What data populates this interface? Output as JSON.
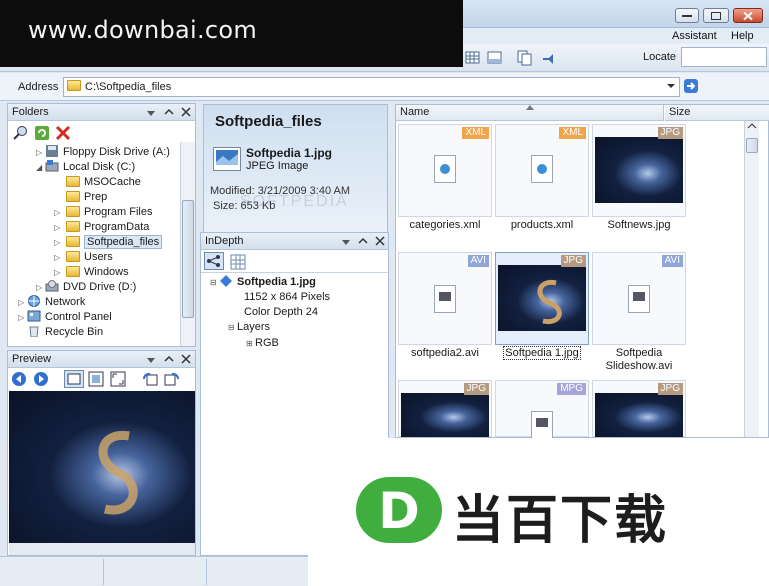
{
  "menu": {
    "assistant": "Assistant",
    "help": "Help"
  },
  "toolbar": {
    "locate_label": "Locate"
  },
  "address": {
    "label": "Address",
    "path": "C:\\Softpedia_files"
  },
  "folders_panel": {
    "title": "Folders",
    "items": [
      {
        "label": "Floppy Disk Drive (A:)",
        "icon": "floppy-icon",
        "depth": 1
      },
      {
        "label": "Local Disk (C:)",
        "icon": "drive-icon",
        "depth": 1
      },
      {
        "label": "MSOCache",
        "icon": "folder-icon",
        "depth": 2
      },
      {
        "label": "Prep",
        "icon": "folder-icon",
        "depth": 2
      },
      {
        "label": "Program Files",
        "icon": "folder-icon",
        "depth": 2
      },
      {
        "label": "ProgramData",
        "icon": "folder-icon",
        "depth": 2
      },
      {
        "label": "Softpedia_files",
        "icon": "folder-icon",
        "depth": 2,
        "selected": true
      },
      {
        "label": "Users",
        "icon": "folder-icon",
        "depth": 2
      },
      {
        "label": "Windows",
        "icon": "folder-icon",
        "depth": 2
      },
      {
        "label": "DVD Drive (D:)",
        "icon": "dvd-icon",
        "depth": 1
      },
      {
        "label": "Network",
        "icon": "network-icon",
        "depth": 0
      },
      {
        "label": "Control Panel",
        "icon": "control-panel-icon",
        "depth": 0
      },
      {
        "label": "Recycle Bin",
        "icon": "recycle-bin-icon",
        "depth": 0
      }
    ]
  },
  "preview_panel": {
    "title": "Preview"
  },
  "info": {
    "folder_name": "Softpedia_files",
    "file_name": "Softpedia 1.jpg",
    "file_type": "JPEG Image",
    "modified": "Modified: 3/21/2009 3:40 AM",
    "size": "Size: 653 Kb"
  },
  "indepth_panel": {
    "title": "InDepth",
    "root": "Softpedia 1.jpg",
    "dimensions": "1152 x 864 Pixels",
    "color_depth": "Color Depth 24",
    "layers": "Layers",
    "layer_child": "RGB"
  },
  "file_list": {
    "columns": {
      "name": "Name",
      "size": "Size"
    },
    "items": [
      {
        "label": "categories.xml",
        "badge": "XML",
        "kind": "doc"
      },
      {
        "label": "products.xml",
        "badge": "XML",
        "kind": "doc"
      },
      {
        "label": "Softnews.jpg",
        "badge": "JPG",
        "kind": "pic"
      },
      {
        "label": "softpedia2.avi",
        "badge": "AVI",
        "kind": "video"
      },
      {
        "label": "Softpedia 1.jpg",
        "badge": "JPG",
        "kind": "pic",
        "selected": true
      },
      {
        "label": "Softpedia Slideshow.avi",
        "badge": "AVI",
        "kind": "video"
      },
      {
        "label": "",
        "badge": "JPG",
        "kind": "pic"
      },
      {
        "label": "",
        "badge": "MPG",
        "kind": "mpg"
      },
      {
        "label": "",
        "badge": "JPG",
        "kind": "pic"
      }
    ]
  },
  "watermark_top": "www.downbai.com",
  "watermark_bottom": "当百下载",
  "watermark_logo_letter": "D",
  "info_watermark": "SOFTPEDIA"
}
